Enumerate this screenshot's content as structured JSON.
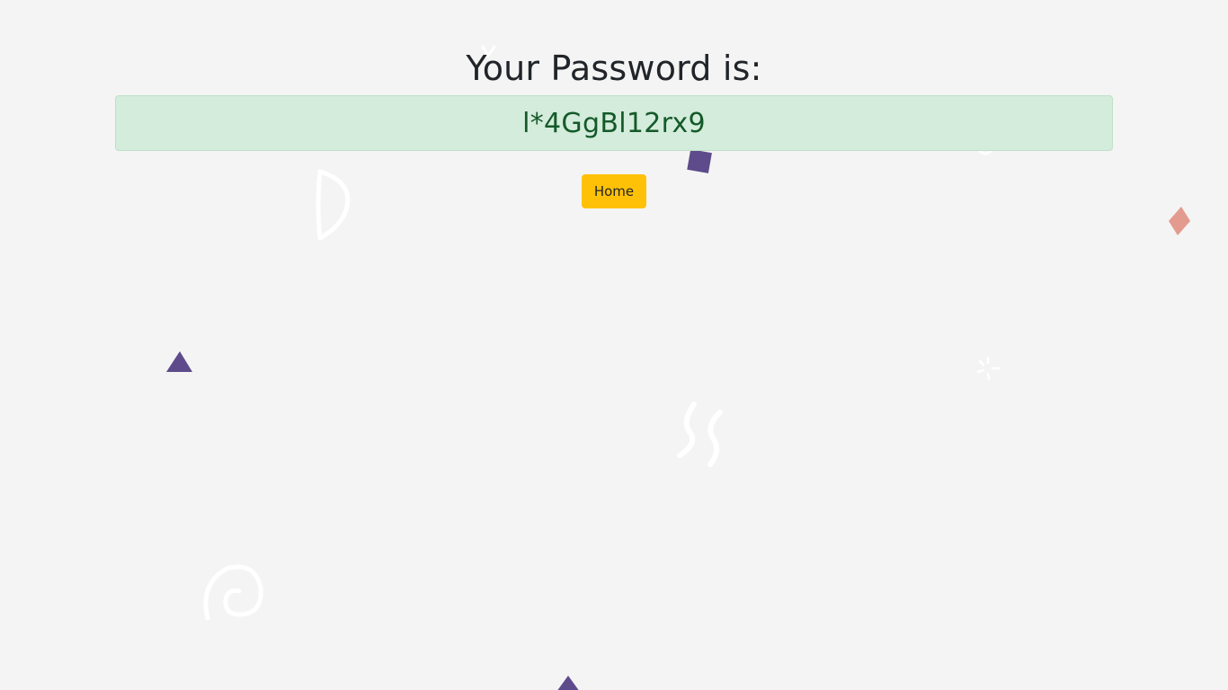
{
  "page": {
    "heading": "Your Password is:",
    "password": "l*4GgBl12rx9",
    "home_label": "Home"
  },
  "colors": {
    "background": "#f4f4f4",
    "alert_bg": "#d4ecdb",
    "alert_text": "#145a2a",
    "button_bg": "#ffc107",
    "confetti_purple": "#5e4b8b",
    "confetti_pink": "#e39a8f",
    "confetti_white": "#ffffff"
  },
  "decorations": [
    "purple-square-confetti",
    "pink-diamond-confetti",
    "purple-triangle-confetti",
    "purple-triangle-confetti-bottom",
    "white-half-circle-squiggle",
    "white-double-wave-squiggle",
    "white-spiral-squiggle",
    "white-sparkle",
    "white-chevron-squiggle"
  ]
}
